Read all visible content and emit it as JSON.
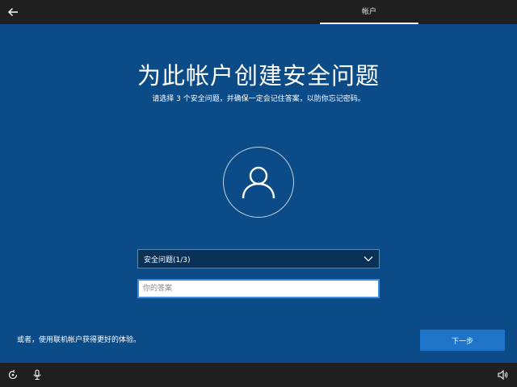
{
  "header": {
    "back_icon": "arrow-left-icon",
    "tab_label": "帐户"
  },
  "main": {
    "title": "为此帐户创建安全问题",
    "subtitle": "请选择 3 个安全问题，并确保一定会记住答案，以防你忘记密码。",
    "avatar_icon": "user-icon"
  },
  "form": {
    "question_select": {
      "selected": "安全问题(1/3)",
      "icon": "chevron-down-icon"
    },
    "answer_input": {
      "placeholder": "你的答案",
      "value": ""
    }
  },
  "footer": {
    "online_account_link": "或者，使用联机帐户获得更好的体验。",
    "next_button": "下一步"
  },
  "bottom_bar": {
    "left_icons": [
      "ease-of-access-icon",
      "microphone-icon"
    ],
    "right_icons": [
      "volume-icon"
    ]
  },
  "colors": {
    "background": "#0b4b87",
    "topbar": "#1f1f1f",
    "accent": "#1e74c8"
  }
}
